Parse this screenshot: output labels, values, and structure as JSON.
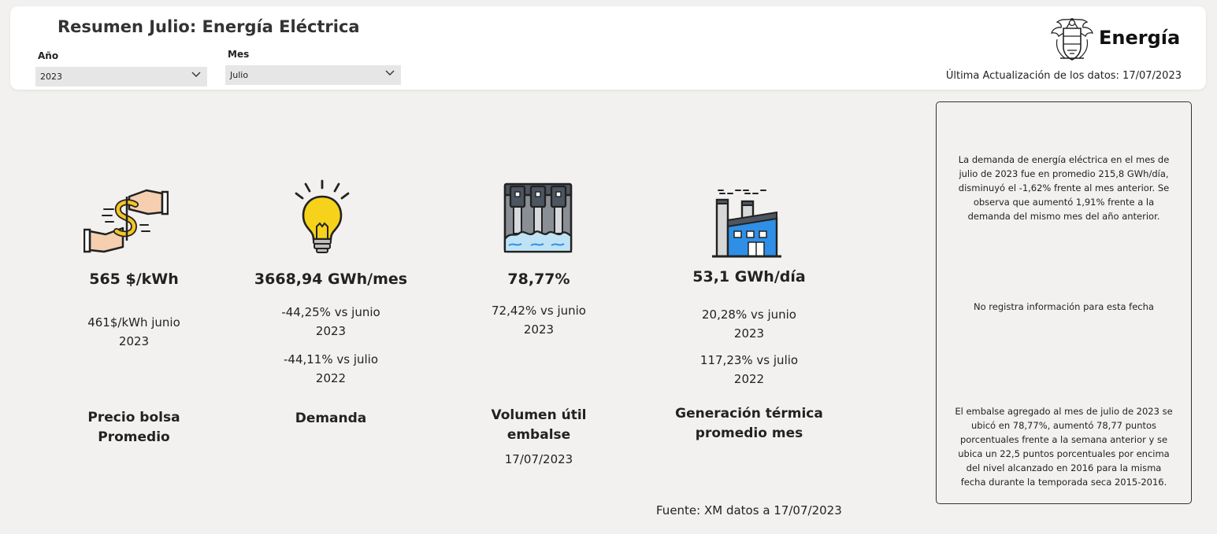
{
  "header": {
    "title": "Resumen Julio: Energía Eléctrica",
    "year_filter": {
      "label": "Año",
      "value": "2023"
    },
    "month_filter": {
      "label": "Mes",
      "value": "Julio"
    },
    "logo_text": "Energía",
    "last_update": "Última Actualización de los datos: 17/07/2023"
  },
  "kpis": {
    "price": {
      "icon": "money-exchange-icon",
      "value": "565 $/kWh",
      "compare1_l1": "461$/kWh junio",
      "compare1_l2": "2023",
      "name_l1": "Precio bolsa",
      "name_l2": "Promedio"
    },
    "demand": {
      "icon": "lightbulb-icon",
      "value": "3668,94 GWh/mes",
      "compare1_l1": "-44,25% vs junio",
      "compare1_l2": "2023",
      "compare2_l1": "-44,11% vs julio",
      "compare2_l2": "2022",
      "name": "Demanda"
    },
    "reservoir": {
      "icon": "dam-icon",
      "value": "78,77%",
      "compare1_l1": "72,42% vs junio",
      "compare1_l2": "2023",
      "name_l1": "Volumen útil",
      "name_l2": "embalse",
      "date": "17/07/2023"
    },
    "thermal": {
      "icon": "factory-icon",
      "value": "53,1 GWh/día",
      "compare1_l1": "20,28% vs junio",
      "compare1_l2": "2023",
      "compare2_l1": "117,23% vs julio",
      "compare2_l2": "2022",
      "name_l1": "Generación térmica",
      "name_l2": "promedio mes"
    }
  },
  "info": {
    "demand_text": "La demanda de energía eléctrica en el mes de julio de 2023 fue en promedio 215,8 GWh/día, disminuyó  el -1,62% frente al mes anterior. Se observa que aumentó 1,91% frente a la demanda del mismo mes del año anterior.",
    "no_info_text": "No registra información para esta fecha",
    "reservoir_text": "El embalse agregado al mes de julio de 2023 se ubicó en 78,77%,  aumentó 78,77 puntos porcentuales frente a la semana anterior y se ubica un 22,5 puntos porcentuales por  encima del nivel alcanzado en 2016 para la misma fecha durante la temporada seca 2015-2016."
  },
  "footer": {
    "source": "Fuente: XM datos a 17/07/2023"
  },
  "colors": {
    "accent_yellow": "#f6c522",
    "accent_blue": "#2f8fe6",
    "background": "#f2f1ef"
  }
}
